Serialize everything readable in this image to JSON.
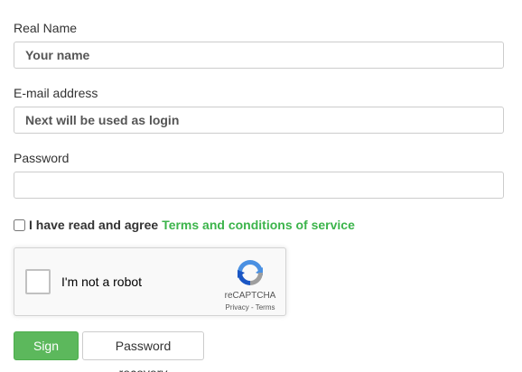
{
  "fields": {
    "real_name": {
      "label": "Real Name",
      "placeholder": "Your name",
      "value": ""
    },
    "email": {
      "label": "E-mail address",
      "placeholder": "Next will be used as login",
      "value": ""
    },
    "password": {
      "label": "Password",
      "placeholder": "",
      "value": ""
    }
  },
  "agreement": {
    "checked": false,
    "text": "I have read and agree",
    "link_text": "Terms and conditions of service",
    "link_color": "#3cb44b"
  },
  "recaptcha": {
    "label": "I'm not a robot",
    "brand": "reCAPTCHA",
    "links": "Privacy - Terms",
    "icon": "recaptcha-logo-icon"
  },
  "buttons": {
    "signup_label": "Sign Up",
    "signup_color": "#5cb85c",
    "recovery_label": "Password recovery"
  }
}
